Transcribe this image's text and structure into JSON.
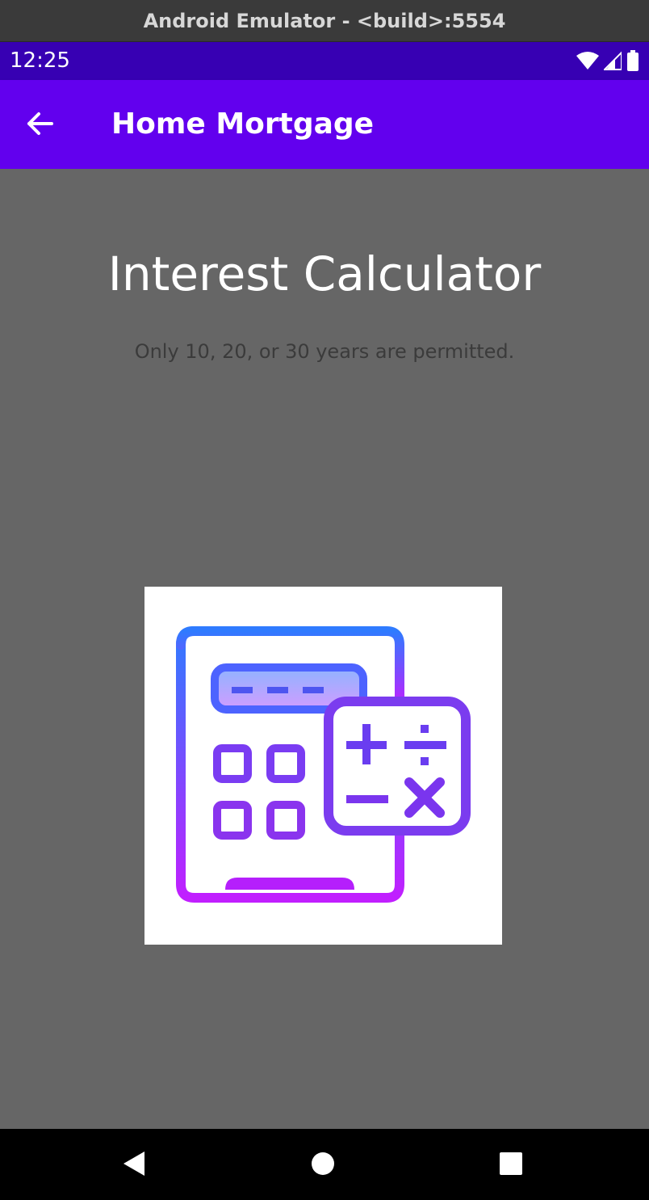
{
  "emulator": {
    "title": "Android Emulator - <build>:5554"
  },
  "status_bar": {
    "time": "12:25",
    "icons": [
      "wifi-icon",
      "signal-icon",
      "battery-icon"
    ],
    "color": "#3700b3"
  },
  "app_bar": {
    "title": "Home Mortgage",
    "back_icon": "arrow-left-icon",
    "color": "#6200ee"
  },
  "content": {
    "heading": "Interest Calculator",
    "subtext": "Only 10, 20, or 30 years are permitted.",
    "image_icon": "calculator-icon",
    "background": "#666666"
  },
  "nav_bar": {
    "buttons": [
      "back-triangle-icon",
      "home-circle-icon",
      "recents-square-icon"
    ]
  }
}
